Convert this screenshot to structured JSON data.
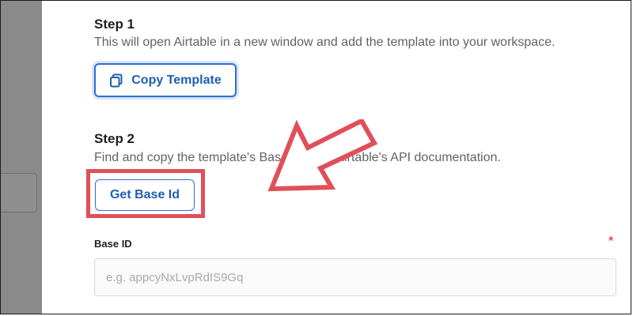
{
  "step1": {
    "title": "Step 1",
    "description": "This will open Airtable in a new window and add the template into your workspace.",
    "button_label": "Copy Template"
  },
  "step2": {
    "title": "Step 2",
    "description": "Find and copy the template's Base ID from Airtable's API documentation.",
    "button_label": "Get Base Id"
  },
  "base_id_field": {
    "label": "Base ID",
    "required_mark": "*",
    "placeholder": "e.g. appcyNxLvpRdIS9Gq",
    "value": ""
  },
  "colors": {
    "accent_blue": "#2f6fd0",
    "annotation_red": "#e0505a",
    "overlay_gray": "#8a8a8a"
  },
  "icons": {
    "copy_button_icon": "copy-icon",
    "annotation_arrow": "annotation-arrow-icon"
  }
}
